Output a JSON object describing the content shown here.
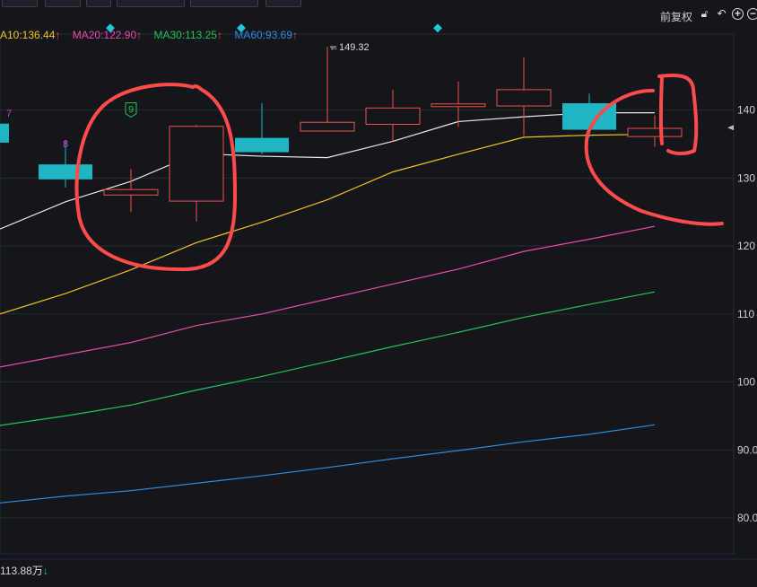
{
  "toolbar": {
    "restore_label": "前复权",
    "lock_icon": "lock-icon",
    "undo_icon": "undo-icon",
    "zoom_in_icon": "zoom-in-icon",
    "zoom_out_icon": "zoom-out-icon"
  },
  "legend": {
    "ma10": "A10:136.44",
    "ma20": "MA20:122.90",
    "ma30": "MA30:113.25",
    "ma60": "MA60:93.69",
    "up_arrow": "↑"
  },
  "volume": {
    "label": "113.88万",
    "arrow": "↓"
  },
  "colors": {
    "background": "#14161b",
    "grid": "#262a31",
    "up_candle": "#f0504a",
    "down_candle": "#1fb5c2",
    "ma5": "#e8e8e8",
    "ma10": "#f3c218",
    "ma20": "#e84aa8",
    "ma30": "#21c45a",
    "ma60": "#2a8de0",
    "annotation": "#ff4a4a",
    "sequence_number": "#d43ccf",
    "marker": "#1fc8d8"
  },
  "chart_data": {
    "type": "candlestick",
    "y_range": [
      77,
      150
    ],
    "y_ticks": [
      "140",
      "130",
      "120",
      "110",
      "100",
      "90.0",
      "80.0"
    ],
    "y_tick_values": [
      140,
      130,
      120,
      110,
      100,
      90,
      80
    ],
    "high_label": "149.32",
    "candles": [
      {
        "o": 138.0,
        "h": 140.5,
        "l": 136.2,
        "c": 135.2,
        "dir": "down"
      },
      {
        "o": 132.0,
        "h": 135.6,
        "l": 128.6,
        "c": 129.8,
        "dir": "down"
      },
      {
        "o": 127.5,
        "h": 131.3,
        "l": 125.0,
        "c": 128.3,
        "dir": "up"
      },
      {
        "o": 126.6,
        "h": 137.8,
        "l": 123.6,
        "c": 137.6,
        "dir": "up"
      },
      {
        "o": 135.9,
        "h": 141.0,
        "l": 133.5,
        "c": 133.8,
        "dir": "down"
      },
      {
        "o": 136.9,
        "h": 149.3,
        "l": 136.9,
        "c": 138.2,
        "dir": "up"
      },
      {
        "o": 137.9,
        "h": 143.0,
        "l": 135.4,
        "c": 140.3,
        "dir": "up"
      },
      {
        "o": 140.5,
        "h": 144.2,
        "l": 137.5,
        "c": 140.9,
        "dir": "up"
      },
      {
        "o": 140.6,
        "h": 147.7,
        "l": 136.2,
        "c": 143.0,
        "dir": "up"
      },
      {
        "o": 141.0,
        "h": 142.4,
        "l": 136.0,
        "c": 137.1,
        "dir": "down"
      },
      {
        "o": 136.1,
        "h": 139.2,
        "l": 134.6,
        "c": 137.3,
        "dir": "up"
      }
    ],
    "sequence_numbers": [
      {
        "index": 0,
        "text": "7",
        "value": 139.0
      },
      {
        "index": 1,
        "text": "8",
        "value": 134.5
      },
      {
        "index": 2,
        "text": "9",
        "value": 140.0
      }
    ],
    "ma_lines": [
      {
        "key": "ma5",
        "values": [
          122.5,
          126.5,
          129.5,
          133.6,
          133.2,
          133.0,
          135.4,
          138.3,
          139.0,
          139.6,
          139.6
        ]
      },
      {
        "key": "ma10",
        "values": [
          110.0,
          113.0,
          116.5,
          120.5,
          123.5,
          126.8,
          130.9,
          133.5,
          136.0,
          136.3,
          136.44
        ]
      },
      {
        "key": "ma20",
        "values": [
          102.2,
          104.0,
          105.8,
          108.3,
          110.0,
          112.2,
          114.4,
          116.6,
          119.2,
          121.0,
          122.9
        ]
      },
      {
        "key": "ma30",
        "values": [
          93.6,
          95.0,
          96.6,
          98.8,
          100.8,
          103.0,
          105.2,
          107.3,
          109.5,
          111.4,
          113.25
        ]
      },
      {
        "key": "ma60",
        "values": [
          82.2,
          83.2,
          84.0,
          85.1,
          86.2,
          87.4,
          88.7,
          89.9,
          91.2,
          92.3,
          93.69
        ]
      }
    ]
  }
}
